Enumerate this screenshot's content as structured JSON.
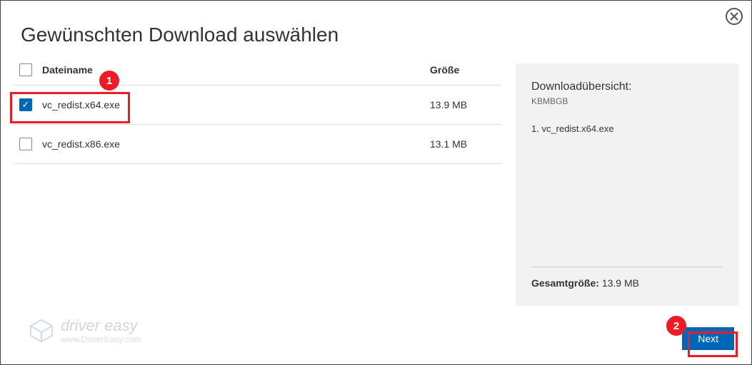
{
  "title": "Gewünschten Download auswählen",
  "columns": {
    "name": "Dateiname",
    "size": "Größe"
  },
  "rows": [
    {
      "name": "vc_redist.x64.exe",
      "size": "13.9 MB",
      "checked": true
    },
    {
      "name": "vc_redist.x86.exe",
      "size": "13.1 MB",
      "checked": false
    }
  ],
  "summary": {
    "title": "Downloadübersicht:",
    "sub": "KBMBGB",
    "item1": "1.  vc_redist.x64.exe",
    "total_label": "Gesamtgröße:",
    "total_value": "13.9 MB"
  },
  "next_button": "Next",
  "annotations": {
    "bubble1": "1",
    "bubble2": "2"
  },
  "watermark": {
    "line1": "driver easy",
    "line2": "www.DriverEasy.com"
  }
}
